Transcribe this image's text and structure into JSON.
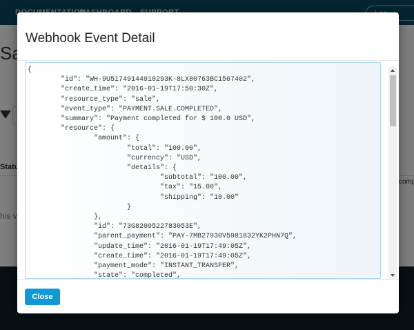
{
  "background": {
    "nav_links": [
      "DOCUMENTATION",
      "DASHBOARD",
      "SUPPORT"
    ],
    "nav_button_label": "Log",
    "page_title_fragment": "Sa",
    "table_header_fragment": "Status",
    "table_cell_fragment": "comp",
    "note_fragment": "his vi"
  },
  "modal": {
    "title": "Webhook Event Detail",
    "json_content": "{\n        \"id\": \"WH-9U51749144910293K-8LX80763BC1567402\",\n        \"create_time\": \"2016-01-19T17:50:30Z\",\n        \"resource_type\": \"sale\",\n        \"event_type\": \"PAYMENT.SALE.COMPLETED\",\n        \"summary\": \"Payment completed for $ 100.0 USD\",\n        \"resource\": {\n                \"amount\": {\n                        \"total\": \"100.00\",\n                        \"currency\": \"USD\",\n                        \"details\": {\n                                \"subtotal\": \"100.00\",\n                                \"tax\": \"15.00\",\n                                \"shipping\": \"10.00\"\n                        }\n                },\n                \"id\": \"73G8209522783053E\",\n                \"parent_payment\": \"PAY-7MB27930V5981832YK2PHN7Q\",\n                \"update_time\": \"2016-01-19T17:49:05Z\",\n                \"create_time\": \"2016-01-19T17:49:05Z\",\n                \"payment_mode\": \"INSTANT_TRANSFER\",\n                \"state\": \"completed\",",
    "close_label": "Close"
  },
  "colors": {
    "primary_button": "#0f9ad6",
    "nav_background": "#0b4a66",
    "code_border": "#a9d6ee"
  }
}
